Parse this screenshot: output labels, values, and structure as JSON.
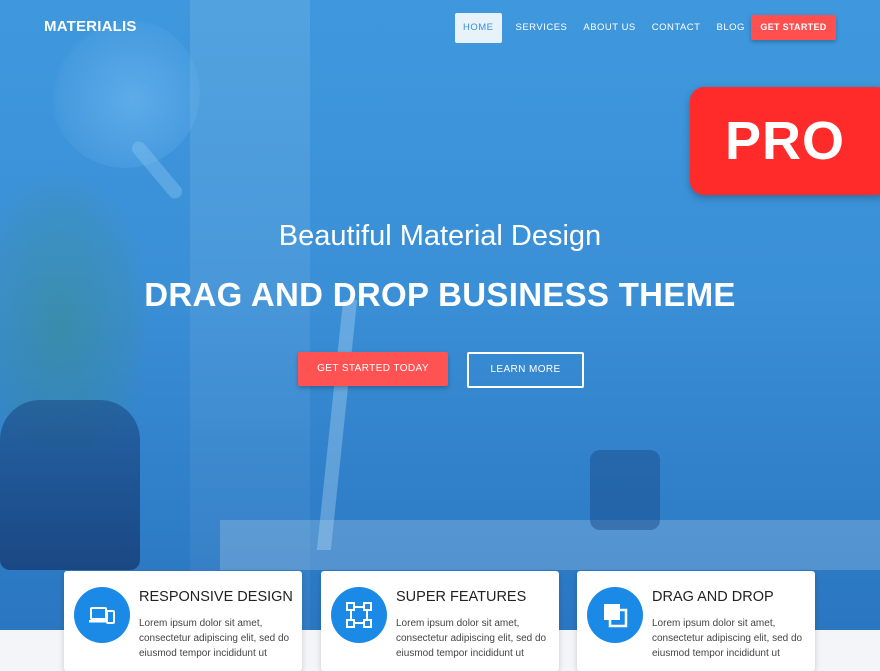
{
  "brand": {
    "logo": "MATERIALIS"
  },
  "nav": {
    "items": [
      {
        "label": "HOME",
        "active": true
      },
      {
        "label": "SERVICES",
        "active": false
      },
      {
        "label": "ABOUT US",
        "active": false
      },
      {
        "label": "CONTACT",
        "active": false
      },
      {
        "label": "BLOG",
        "active": false
      }
    ],
    "cta_label": "GET STARTED"
  },
  "badge": {
    "label": "PRO"
  },
  "hero": {
    "subtitle": "Beautiful Material Design",
    "title": "DRAG AND DROP BUSINESS THEME",
    "primary_button": "GET STARTED TODAY",
    "secondary_button": "LEARN MORE"
  },
  "features": [
    {
      "title": "RESPONSIVE DESIGN",
      "icon": "devices-icon",
      "text": "Lorem ipsum dolor sit amet, consectetur adipiscing elit, sed do eiusmod tempor incididunt ut"
    },
    {
      "title": "SUPER FEATURES",
      "icon": "vector-square-icon",
      "text": "Lorem ipsum dolor sit amet, consectetur adipiscing elit, sed do eiusmod tempor incididunt ut"
    },
    {
      "title": "DRAG AND DROP",
      "icon": "layers-icon",
      "text": "Lorem ipsum dolor sit amet, consectetur adipiscing elit, sed do eiusmod tempor incididunt ut"
    }
  ],
  "colors": {
    "hero_blue": "#3a8fd6",
    "accent_red": "#ff5252",
    "badge_red": "#ff2b2b",
    "icon_blue": "#1a8ae6"
  }
}
